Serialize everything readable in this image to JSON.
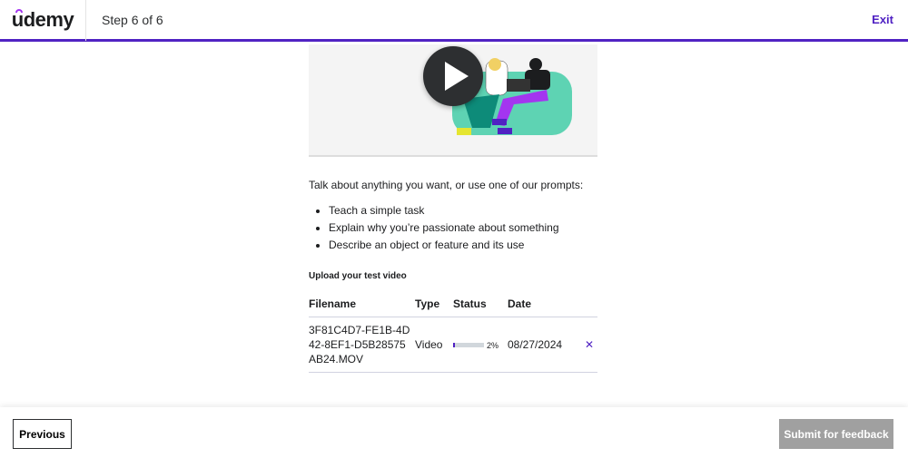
{
  "header": {
    "logo": "udemy",
    "step": "Step 6 of 6",
    "exit": "Exit"
  },
  "main": {
    "intro": "Talk about anything you want, or use one of our prompts:",
    "prompts": [
      "Teach a simple task",
      "Explain why you’re passionate about something",
      "Describe an object or feature and its use"
    ],
    "upload_title": "Upload your test video",
    "columns": [
      "Filename",
      "Type",
      "Status",
      "Date"
    ],
    "rows": [
      {
        "filename": "3F81C4D7-FE1B-4D42-8EF1-D5B28575AB24.MOV",
        "filename_lines": [
          "3F81C4D7-FE1B-4D",
          "42-8EF1-D5B28575",
          "AB24.MOV"
        ],
        "type": "Video",
        "progress": 2,
        "progress_label": "2%",
        "date": "08/27/2024"
      }
    ]
  },
  "footer": {
    "previous": "Previous",
    "submit": "Submit for feedback"
  },
  "colors": {
    "accent": "#5022c3",
    "logo_hat": "#a435f0",
    "disabled": "#a0a0a0"
  }
}
